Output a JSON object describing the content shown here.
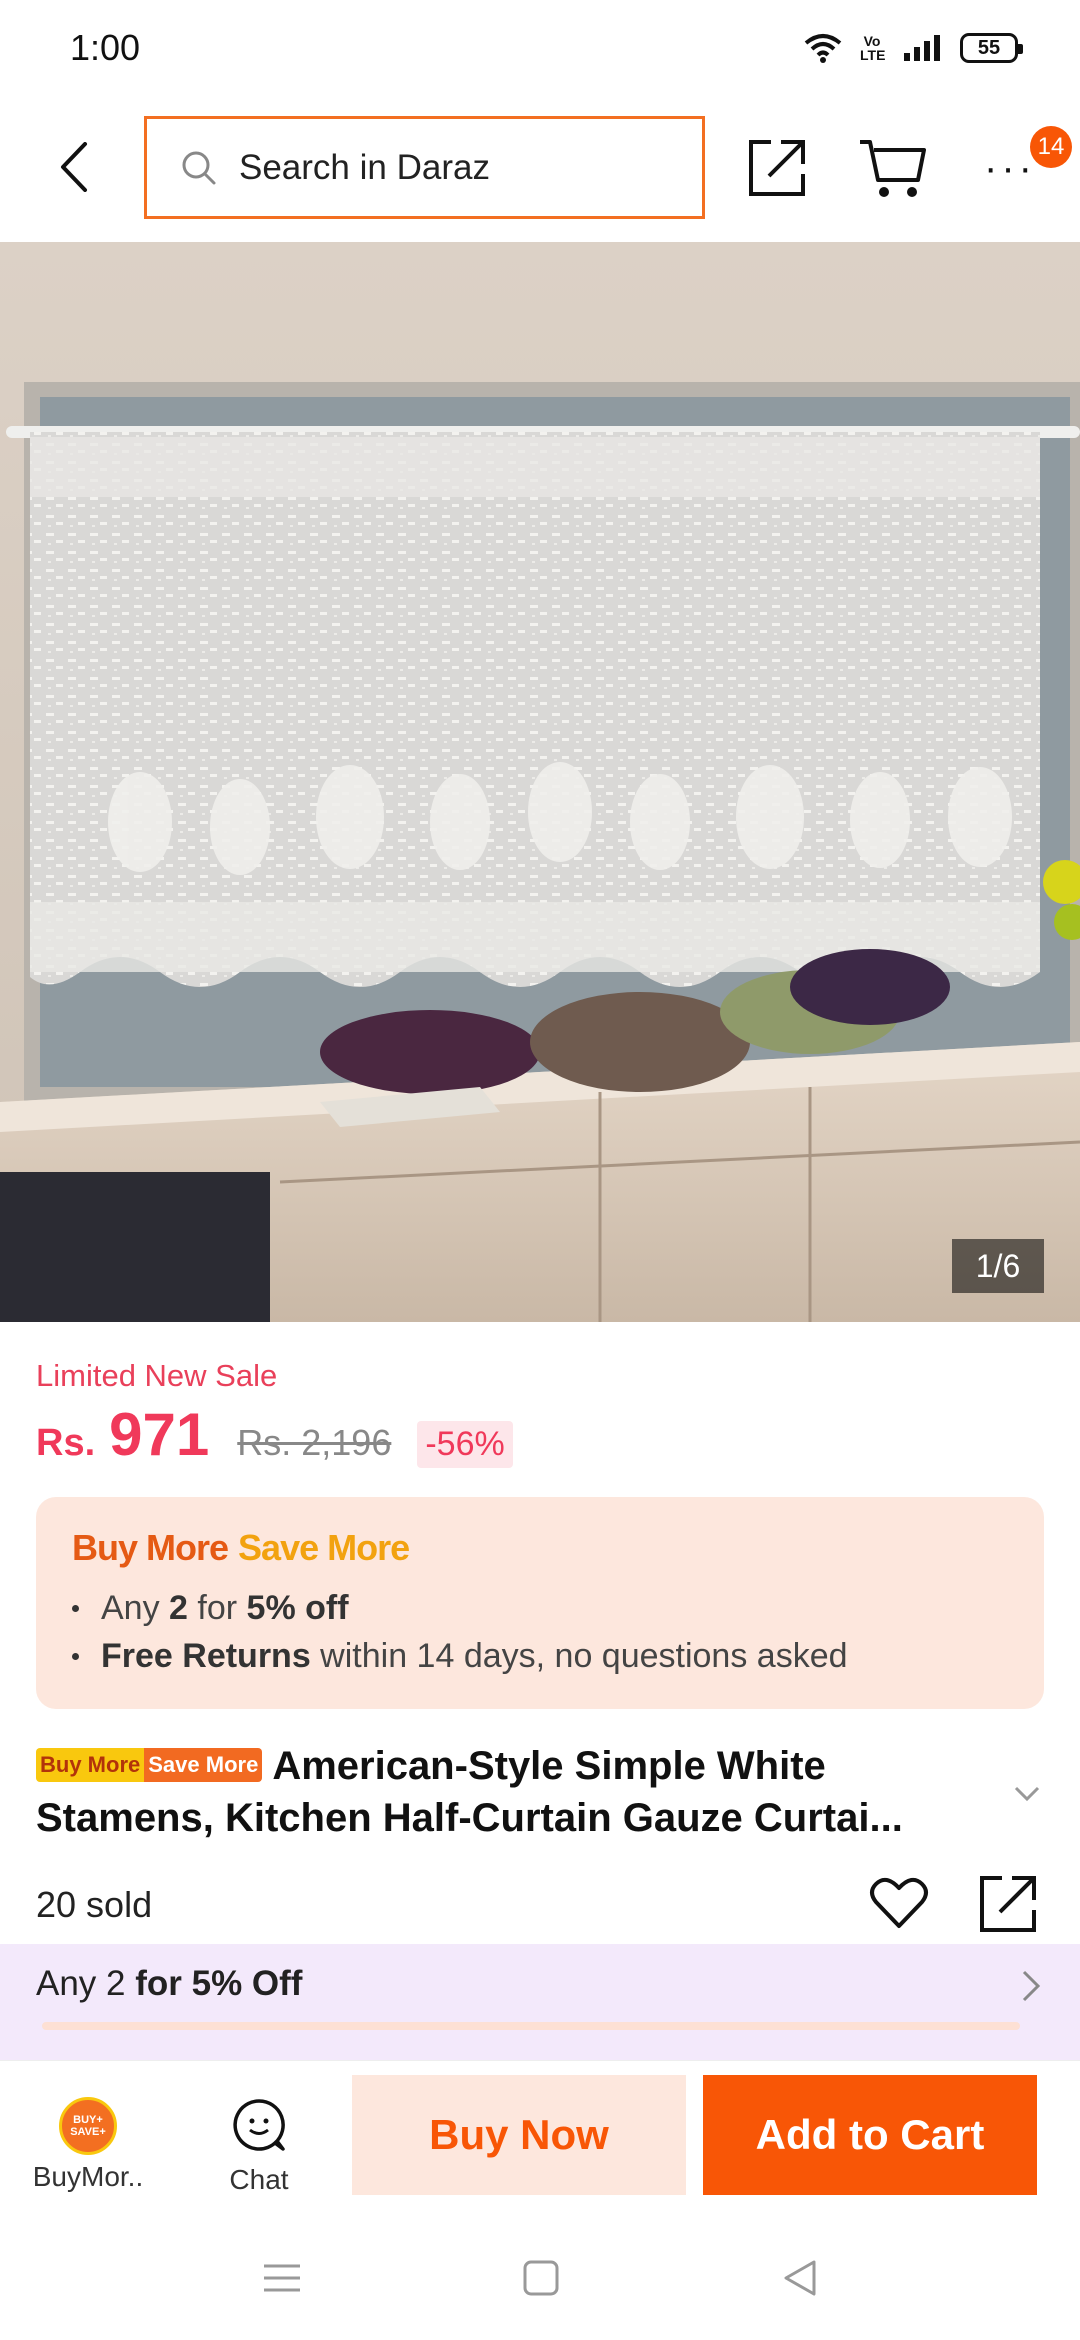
{
  "status_bar": {
    "time": "1:00",
    "battery": "55",
    "volte": "Vo LTE",
    "icons": [
      "wifi-icon",
      "volte-icon",
      "signal-icon",
      "battery-icon"
    ]
  },
  "header": {
    "search_placeholder": "Search in Daraz",
    "cart_badge": "14",
    "icons": [
      "back-arrow-icon",
      "search-icon",
      "share-icon",
      "cart-icon",
      "more-icon"
    ]
  },
  "gallery": {
    "counter": "1/6"
  },
  "price": {
    "label": "Limited New Sale",
    "currency": "Rs.",
    "current": "971",
    "original": "Rs. 2,196",
    "discount": "-56%"
  },
  "promo": {
    "logo_part1": "Buy More",
    "logo_part2": "Save More",
    "line1_pre": "Any ",
    "line1_bold1": "2",
    "line1_mid": " for ",
    "line1_bold2": "5% off",
    "line2_bold": "Free Returns",
    "line2_rest": " within 14 days, no questions asked"
  },
  "product": {
    "tag_part1": "Buy More",
    "tag_part2": "Save More",
    "title": "American-Style Simple White Stamens, Kitchen Half-Curtain Gauze Curtai...",
    "sold": "20 sold"
  },
  "offer_strip": {
    "pre": "Any 2 ",
    "bold": "for 5% Off"
  },
  "bottom_bar": {
    "buymore_label": "BuyMor..",
    "buymore_icon_text": "BUY+ SAVE+",
    "chat_label": "Chat",
    "buy_now": "Buy Now",
    "add_to_cart": "Add to Cart"
  },
  "colors": {
    "brand_orange": "#f85606",
    "price_red": "#f0395a",
    "promo_bg": "#fde7dd",
    "offer_bg": "#f3e9fb"
  }
}
